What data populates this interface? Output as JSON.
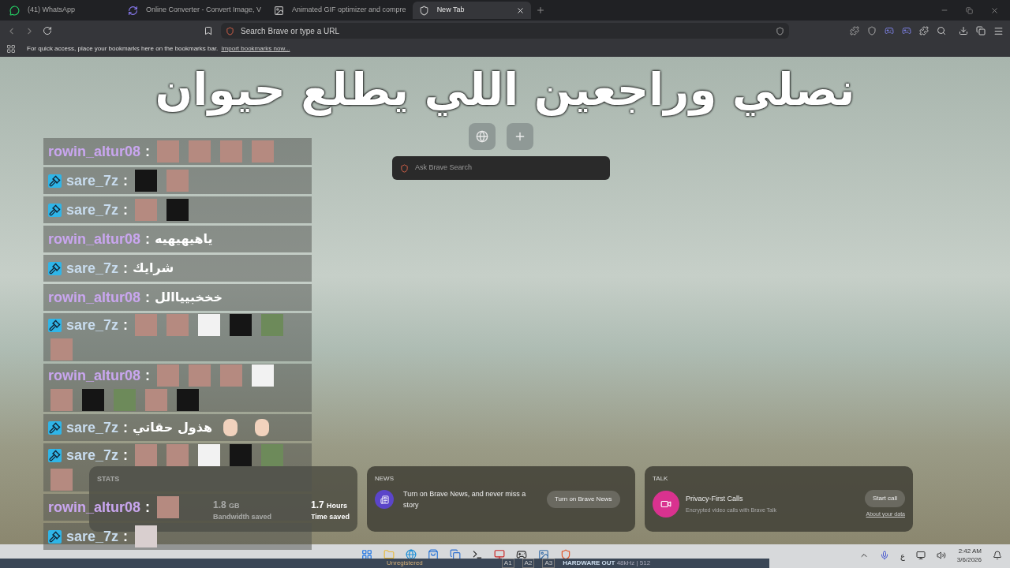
{
  "tabs": [
    {
      "label": "(41) WhatsApp",
      "selected": false
    },
    {
      "label": "Online Converter - Convert Image, V",
      "selected": false
    },
    {
      "label": "Animated GIF optimizer and compre",
      "selected": false
    },
    {
      "label": "New Tab",
      "selected": true
    }
  ],
  "address_bar": {
    "placeholder": "Search Brave or type a URL"
  },
  "bookmarks_bar": {
    "text": "For quick access, place your bookmarks here on the bookmarks bar.",
    "link": "Import bookmarks now..."
  },
  "caption": "نصلي وراجعين اللي يطلع حيوان",
  "search_box": {
    "placeholder": "Ask Brave Search"
  },
  "chat": [
    {
      "user": "rowin_altur08",
      "color": "#c9a6ef",
      "moderator": false,
      "separator": ":",
      "emotes": [
        {
          "kind": "face"
        },
        {
          "kind": "face"
        },
        {
          "kind": "face"
        },
        {
          "kind": "face"
        }
      ]
    },
    {
      "user": "sare_7z",
      "color": "#c8dcee",
      "moderator": true,
      "separator": ":",
      "emotes": [
        {
          "kind": "dark"
        },
        {
          "kind": "face"
        }
      ]
    },
    {
      "user": "sare_7z",
      "color": "#c8dcee",
      "moderator": true,
      "separator": ":",
      "emotes": [
        {
          "kind": "face"
        },
        {
          "kind": "dark"
        }
      ]
    },
    {
      "user": "rowin_altur08",
      "color": "#c9a6ef",
      "moderator": false,
      "separator": ":",
      "text": "ياهيهيهيه"
    },
    {
      "user": "sare_7z",
      "color": "#c8dcee",
      "moderator": true,
      "separator": ":",
      "text": "شرايك"
    },
    {
      "user": "rowin_altur08",
      "color": "#c9a6ef",
      "moderator": false,
      "separator": ":",
      "text": "خخخبيياالل"
    },
    {
      "user": "sare_7z",
      "color": "#c8dcee",
      "moderator": true,
      "separator": ":",
      "emotes": [
        {
          "kind": "face"
        },
        {
          "kind": "face"
        },
        {
          "kind": "doc"
        },
        {
          "kind": "dark"
        },
        {
          "kind": "green"
        },
        {
          "kind": "face"
        }
      ]
    },
    {
      "user": "rowin_altur08",
      "color": "#c9a6ef",
      "moderator": false,
      "separator": ":",
      "emotes": [
        {
          "kind": "face"
        },
        {
          "kind": "face"
        },
        {
          "kind": "face"
        },
        {
          "kind": "doc"
        },
        {
          "kind": "face"
        },
        {
          "kind": "dark"
        },
        {
          "kind": "green"
        },
        {
          "kind": "face"
        },
        {
          "kind": "dark"
        }
      ]
    },
    {
      "user": "sare_7z",
      "color": "#c8dcee",
      "moderator": true,
      "separator": ":",
      "text": "هذول حقاتي",
      "emotes": [
        {
          "kind": "hand"
        },
        {
          "kind": "hand"
        }
      ]
    },
    {
      "user": "sare_7z",
      "color": "#c8dcee",
      "moderator": true,
      "separator": ":",
      "emotes": [
        {
          "kind": "face"
        },
        {
          "kind": "face"
        },
        {
          "kind": "doc"
        },
        {
          "kind": "dark"
        },
        {
          "kind": "green"
        },
        {
          "kind": "face"
        }
      ]
    },
    {
      "user": "rowin_altur08",
      "color": "#c9a6ef",
      "moderator": false,
      "separator": ":",
      "emotes": [
        {
          "kind": "face"
        }
      ]
    },
    {
      "user": "sare_7z",
      "color": "#c8dcee",
      "moderator": true,
      "separator": ":",
      "emotes": [
        {
          "kind": "cat"
        }
      ]
    }
  ],
  "stats": {
    "title": "STATS",
    "items": [
      {
        "value": "1.8",
        "unit": "GB",
        "label": "Bandwidth saved"
      },
      {
        "value": "1.7",
        "unit": "Hours",
        "label": "Time saved"
      }
    ]
  },
  "news": {
    "title": "NEWS",
    "text": "Turn on Brave News, and never miss a story",
    "button": "Turn on Brave News"
  },
  "talk": {
    "title": "TALK",
    "heading": "Privacy-First Calls",
    "subtext": "Encrypted video calls with Brave Talk",
    "button": "Start call",
    "link": "About your data"
  },
  "tray": {
    "language": "ع",
    "time": "2:42 AM",
    "date": "3/6/2026"
  },
  "mixer": {
    "status": "Unregistered",
    "buses": [
      "A1",
      "A2",
      "A3"
    ],
    "output": "HARDWARE OUT",
    "rate": "48kHz | 512"
  }
}
